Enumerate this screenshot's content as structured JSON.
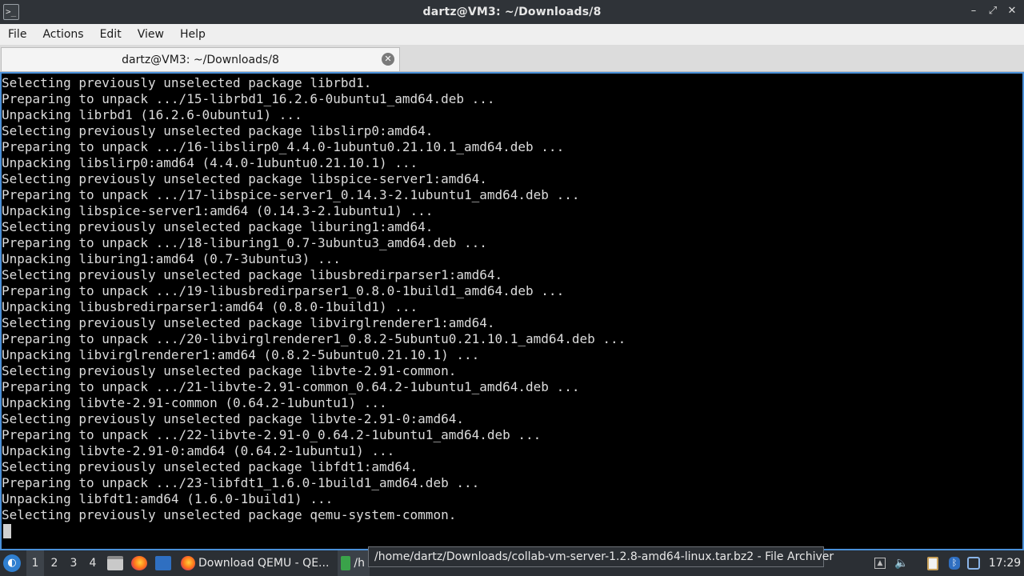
{
  "window": {
    "title": "dartz@VM3: ~/Downloads/8",
    "icon": "terminal-icon",
    "controls": {
      "minimize": "–",
      "maximize": "⤢",
      "close": "✕"
    }
  },
  "menu": {
    "items": [
      "File",
      "Actions",
      "Edit",
      "View",
      "Help"
    ]
  },
  "tabs": [
    {
      "label": "dartz@VM3: ~/Downloads/8",
      "close_icon": "close-icon"
    }
  ],
  "terminal": {
    "lines": [
      "Selecting previously unselected package librbd1.",
      "Preparing to unpack .../15-librbd1_16.2.6-0ubuntu1_amd64.deb ...",
      "Unpacking librbd1 (16.2.6-0ubuntu1) ...",
      "Selecting previously unselected package libslirp0:amd64.",
      "Preparing to unpack .../16-libslirp0_4.4.0-1ubuntu0.21.10.1_amd64.deb ...",
      "Unpacking libslirp0:amd64 (4.4.0-1ubuntu0.21.10.1) ...",
      "Selecting previously unselected package libspice-server1:amd64.",
      "Preparing to unpack .../17-libspice-server1_0.14.3-2.1ubuntu1_amd64.deb ...",
      "Unpacking libspice-server1:amd64 (0.14.3-2.1ubuntu1) ...",
      "Selecting previously unselected package liburing1:amd64.",
      "Preparing to unpack .../18-liburing1_0.7-3ubuntu3_amd64.deb ...",
      "Unpacking liburing1:amd64 (0.7-3ubuntu3) ...",
      "Selecting previously unselected package libusbredirparser1:amd64.",
      "Preparing to unpack .../19-libusbredirparser1_0.8.0-1build1_amd64.deb ...",
      "Unpacking libusbredirparser1:amd64 (0.8.0-1build1) ...",
      "Selecting previously unselected package libvirglrenderer1:amd64.",
      "Preparing to unpack .../20-libvirglrenderer1_0.8.2-5ubuntu0.21.10.1_amd64.deb ...",
      "Unpacking libvirglrenderer1:amd64 (0.8.2-5ubuntu0.21.10.1) ...",
      "Selecting previously unselected package libvte-2.91-common.",
      "Preparing to unpack .../21-libvte-2.91-common_0.64.2-1ubuntu1_amd64.deb ...",
      "Unpacking libvte-2.91-common (0.64.2-1ubuntu1) ...",
      "Selecting previously unselected package libvte-2.91-0:amd64.",
      "Preparing to unpack .../22-libvte-2.91-0_0.64.2-1ubuntu1_amd64.deb ...",
      "Unpacking libvte-2.91-0:amd64 (0.64.2-1ubuntu1) ...",
      "Selecting previously unselected package libfdt1:amd64.",
      "Preparing to unpack .../23-libfdt1_1.6.0-1build1_amd64.deb ...",
      "Unpacking libfdt1:amd64 (1.6.0-1build1) ...",
      "Selecting previously unselected package qemu-system-common."
    ]
  },
  "taskbar": {
    "workspaces": [
      "1",
      "2",
      "3",
      "4"
    ],
    "active_workspace": "1",
    "quicklaunch": [
      "file-manager-icon",
      "firefox-icon",
      "desktop-icon"
    ],
    "tasks": [
      {
        "label": "Download QEMU - QE...",
        "icon": "firefox-icon"
      },
      {
        "label": "/h",
        "icon": "archive-icon"
      }
    ],
    "tray": [
      "tray-up-arrow-icon",
      "volume-icon",
      "clipboard-icon",
      "bluetooth-icon",
      "network-icon"
    ],
    "clock": "17:29"
  },
  "tooltip": {
    "text": "/home/dartz/Downloads/collab-vm-server-1.2.8-amd64-linux.tar.bz2 - File Archiver"
  },
  "colors": {
    "titlebar_bg": "#2f3338",
    "terminal_bg": "#000000",
    "terminal_fg": "#dcdcdc",
    "terminal_border": "#4a90d9",
    "taskbar_bg": "#2b2f34"
  }
}
